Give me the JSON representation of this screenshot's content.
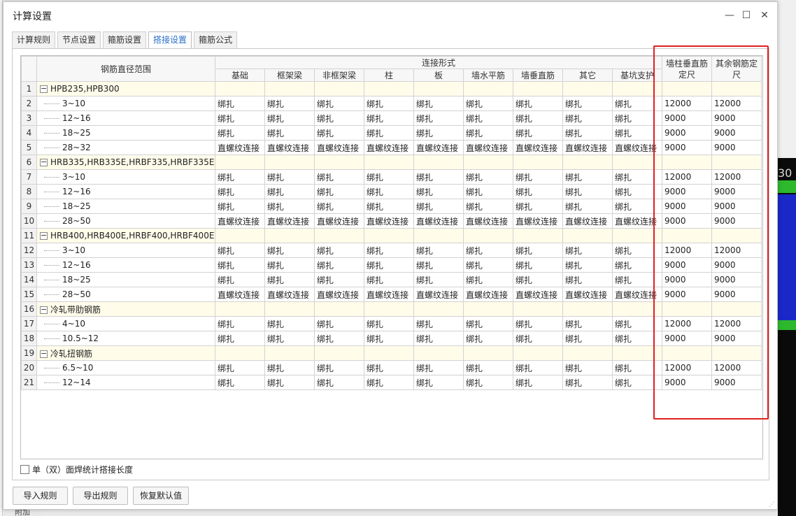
{
  "dialog": {
    "title": "计算设置",
    "window_controls": {
      "minimize": "—",
      "maximize": "☐",
      "close": "✕"
    }
  },
  "tabs": [
    {
      "label": "计算规则",
      "active": false
    },
    {
      "label": "节点设置",
      "active": false
    },
    {
      "label": "箍筋设置",
      "active": false
    },
    {
      "label": "搭接设置",
      "active": true
    },
    {
      "label": "箍筋公式",
      "active": false
    }
  ],
  "grid": {
    "header_range": "钢筋直径范围",
    "header_connection": "连接形式",
    "connection_columns": [
      "基础",
      "框架梁",
      "非框架梁",
      "柱",
      "板",
      "墙水平筋",
      "墙垂直筋",
      "其它",
      "基坑支护"
    ],
    "extra_columns": [
      "墙柱垂直筋定尺",
      "其余钢筋定尺"
    ],
    "rows": [
      {
        "num": "1",
        "type": "group",
        "label": "HPB235,HPB300"
      },
      {
        "num": "2",
        "type": "item",
        "label": "3~10",
        "cells": [
          "绑扎",
          "绑扎",
          "绑扎",
          "绑扎",
          "绑扎",
          "绑扎",
          "绑扎",
          "绑扎",
          "绑扎"
        ],
        "wall_len": "12000",
        "other_len": "12000"
      },
      {
        "num": "3",
        "type": "item",
        "label": "12~16",
        "cells": [
          "绑扎",
          "绑扎",
          "绑扎",
          "绑扎",
          "绑扎",
          "绑扎",
          "绑扎",
          "绑扎",
          "绑扎"
        ],
        "wall_len": "9000",
        "other_len": "9000"
      },
      {
        "num": "4",
        "type": "item",
        "label": "18~25",
        "cells": [
          "绑扎",
          "绑扎",
          "绑扎",
          "绑扎",
          "绑扎",
          "绑扎",
          "绑扎",
          "绑扎",
          "绑扎"
        ],
        "wall_len": "9000",
        "other_len": "9000"
      },
      {
        "num": "5",
        "type": "item",
        "label": "28~32",
        "cells": [
          "直螺纹连接",
          "直螺纹连接",
          "直螺纹连接",
          "直螺纹连接",
          "直螺纹连接",
          "直螺纹连接",
          "直螺纹连接",
          "直螺纹连接",
          "直螺纹连接"
        ],
        "wall_len": "9000",
        "other_len": "9000"
      },
      {
        "num": "6",
        "type": "group",
        "label": "HRB335,HRB335E,HRBF335,HRBF335E"
      },
      {
        "num": "7",
        "type": "item",
        "label": "3~10",
        "cells": [
          "绑扎",
          "绑扎",
          "绑扎",
          "绑扎",
          "绑扎",
          "绑扎",
          "绑扎",
          "绑扎",
          "绑扎"
        ],
        "wall_len": "12000",
        "other_len": "12000"
      },
      {
        "num": "8",
        "type": "item",
        "label": "12~16",
        "cells": [
          "绑扎",
          "绑扎",
          "绑扎",
          "绑扎",
          "绑扎",
          "绑扎",
          "绑扎",
          "绑扎",
          "绑扎"
        ],
        "wall_len": "9000",
        "other_len": "9000"
      },
      {
        "num": "9",
        "type": "item",
        "label": "18~25",
        "cells": [
          "绑扎",
          "绑扎",
          "绑扎",
          "绑扎",
          "绑扎",
          "绑扎",
          "绑扎",
          "绑扎",
          "绑扎"
        ],
        "wall_len": "9000",
        "other_len": "9000"
      },
      {
        "num": "10",
        "type": "item",
        "label": "28~50",
        "cells": [
          "直螺纹连接",
          "直螺纹连接",
          "直螺纹连接",
          "直螺纹连接",
          "直螺纹连接",
          "直螺纹连接",
          "直螺纹连接",
          "直螺纹连接",
          "直螺纹连接"
        ],
        "wall_len": "9000",
        "other_len": "9000"
      },
      {
        "num": "11",
        "type": "group",
        "label": "HRB400,HRB400E,HRBF400,HRBF400E..."
      },
      {
        "num": "12",
        "type": "item",
        "label": "3~10",
        "cells": [
          "绑扎",
          "绑扎",
          "绑扎",
          "绑扎",
          "绑扎",
          "绑扎",
          "绑扎",
          "绑扎",
          "绑扎"
        ],
        "wall_len": "12000",
        "other_len": "12000"
      },
      {
        "num": "13",
        "type": "item",
        "label": "12~16",
        "cells": [
          "绑扎",
          "绑扎",
          "绑扎",
          "绑扎",
          "绑扎",
          "绑扎",
          "绑扎",
          "绑扎",
          "绑扎"
        ],
        "wall_len": "9000",
        "other_len": "9000"
      },
      {
        "num": "14",
        "type": "item",
        "label": "18~25",
        "cells": [
          "绑扎",
          "绑扎",
          "绑扎",
          "绑扎",
          "绑扎",
          "绑扎",
          "绑扎",
          "绑扎",
          "绑扎"
        ],
        "wall_len": "9000",
        "other_len": "9000"
      },
      {
        "num": "15",
        "type": "item",
        "label": "28~50",
        "cells": [
          "直螺纹连接",
          "直螺纹连接",
          "直螺纹连接",
          "直螺纹连接",
          "直螺纹连接",
          "直螺纹连接",
          "直螺纹连接",
          "直螺纹连接",
          "直螺纹连接"
        ],
        "wall_len": "9000",
        "other_len": "9000"
      },
      {
        "num": "16",
        "type": "group",
        "label": "冷轧带肋钢筋"
      },
      {
        "num": "17",
        "type": "item",
        "label": "4~10",
        "cells": [
          "绑扎",
          "绑扎",
          "绑扎",
          "绑扎",
          "绑扎",
          "绑扎",
          "绑扎",
          "绑扎",
          "绑扎"
        ],
        "wall_len": "12000",
        "other_len": "12000"
      },
      {
        "num": "18",
        "type": "item",
        "label": "10.5~12",
        "cells": [
          "绑扎",
          "绑扎",
          "绑扎",
          "绑扎",
          "绑扎",
          "绑扎",
          "绑扎",
          "绑扎",
          "绑扎"
        ],
        "wall_len": "9000",
        "other_len": "9000"
      },
      {
        "num": "19",
        "type": "group",
        "label": "冷轧扭钢筋"
      },
      {
        "num": "20",
        "type": "item",
        "label": "6.5~10",
        "cells": [
          "绑扎",
          "绑扎",
          "绑扎",
          "绑扎",
          "绑扎",
          "绑扎",
          "绑扎",
          "绑扎",
          "绑扎"
        ],
        "wall_len": "12000",
        "other_len": "12000"
      },
      {
        "num": "21",
        "type": "item",
        "label": "12~14",
        "cells": [
          "绑扎",
          "绑扎",
          "绑扎",
          "绑扎",
          "绑扎",
          "绑扎",
          "绑扎",
          "绑扎",
          "绑扎"
        ],
        "wall_len": "9000",
        "other_len": "9000"
      }
    ]
  },
  "checkbox": {
    "label": "单（双）面焊统计搭接长度",
    "checked": false
  },
  "buttons": {
    "import": "导入规则",
    "export": "导出规则",
    "restore": "恢复默认值"
  },
  "background": {
    "number_fragment": "30",
    "bottom_tab": "附加"
  },
  "colors": {
    "highlight": "#e02020",
    "group_row": "#fffcea",
    "active_tab": "#2a6fc9"
  }
}
